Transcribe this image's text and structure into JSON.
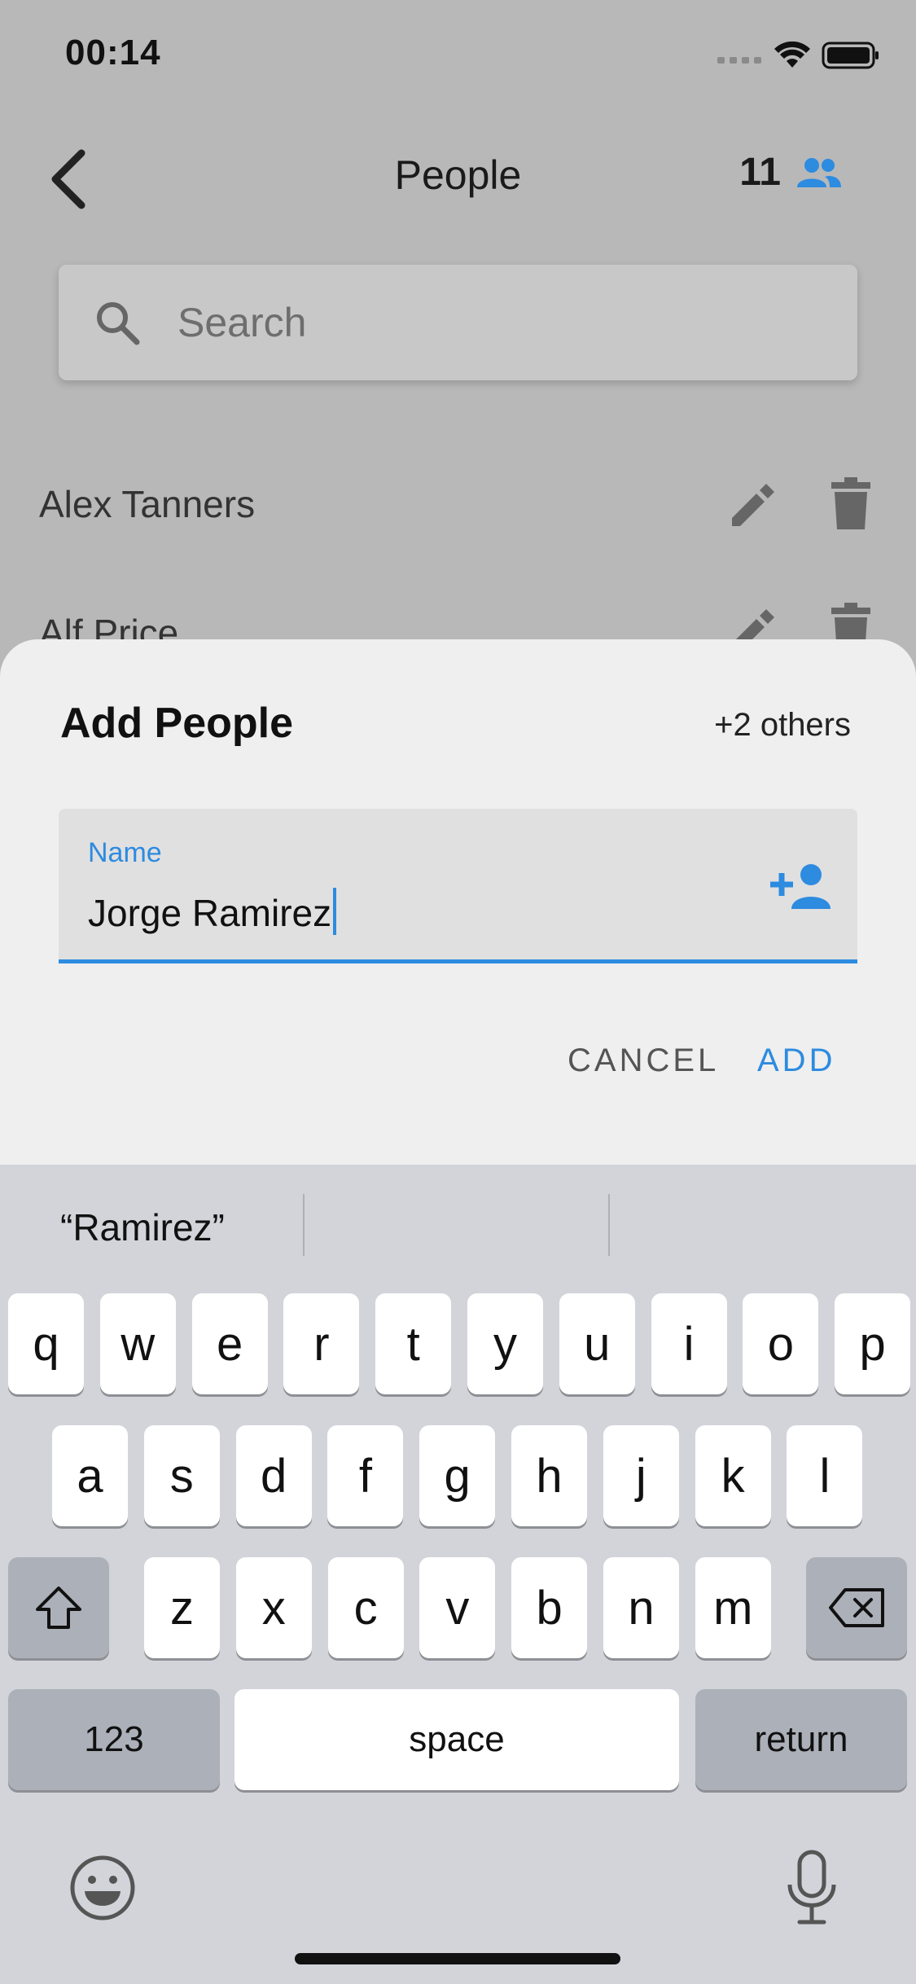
{
  "status_bar": {
    "time": "00:14"
  },
  "header": {
    "title": "People",
    "count": "11"
  },
  "search": {
    "placeholder": "Search"
  },
  "people": [
    {
      "name": "Alex Tanners"
    },
    {
      "name": "Alf Price"
    }
  ],
  "sheet": {
    "title": "Add People",
    "others": "+2 others",
    "field_label": "Name",
    "field_value": "Jorge Ramirez",
    "cancel_label": "CANCEL",
    "add_label": "ADD"
  },
  "keyboard": {
    "suggestions": [
      "“Ramirez”",
      "",
      ""
    ],
    "row1": [
      "q",
      "w",
      "e",
      "r",
      "t",
      "y",
      "u",
      "i",
      "o",
      "p"
    ],
    "row2": [
      "a",
      "s",
      "d",
      "f",
      "g",
      "h",
      "j",
      "k",
      "l"
    ],
    "row3": [
      "z",
      "x",
      "c",
      "v",
      "b",
      "n",
      "m"
    ],
    "numbers_label": "123",
    "space_label": "space",
    "return_label": "return"
  },
  "colors": {
    "accent": "#2d8be0",
    "sheet_bg": "#efefef",
    "keyboard_bg": "#d2d4da"
  }
}
